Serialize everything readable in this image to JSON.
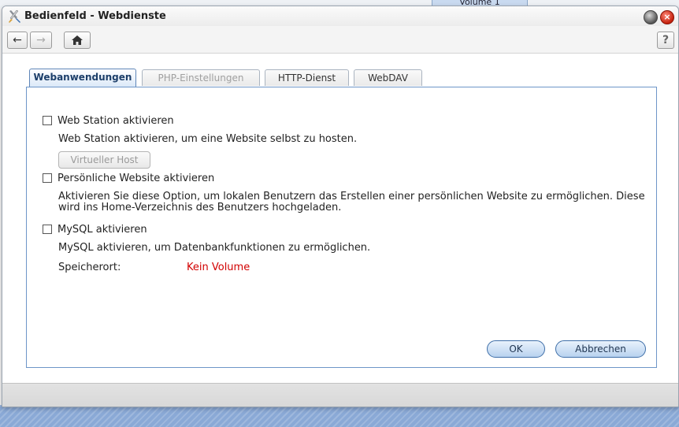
{
  "background": {
    "volume_label": "Volume 1"
  },
  "window": {
    "title": "Bedienfeld - Webdienste",
    "close_symbol": "×"
  },
  "toolbar": {
    "back_icon": "←",
    "forward_icon": "→",
    "home_icon": "⌂",
    "help_label": "?"
  },
  "tabs": [
    {
      "label": "Webanwendungen",
      "state": "active"
    },
    {
      "label": "PHP-Einstellungen",
      "state": "disabled"
    },
    {
      "label": "HTTP-Dienst",
      "state": "normal"
    },
    {
      "label": "WebDAV",
      "state": "normal"
    }
  ],
  "web_station": {
    "checkbox_label": "Web Station aktivieren",
    "checked": false,
    "description": "Web Station aktivieren, um eine Website selbst zu hosten.",
    "virtual_host_button": "Virtueller Host"
  },
  "personal_website": {
    "checkbox_label": "Persönliche Website aktivieren",
    "checked": false,
    "description_line1": "Aktivieren Sie diese Option, um lokalen Benutzern das Erstellen einer persönlichen Website zu ermöglichen. Diese",
    "description_line2": "wird ins Home-Verzeichnis des Benutzers hochgeladen."
  },
  "mysql": {
    "checkbox_label": "MySQL aktivieren",
    "checked": false,
    "description": "MySQL aktivieren, um Datenbankfunktionen zu ermöglichen.",
    "location_label": "Speicherort:",
    "location_value": "Kein Volume"
  },
  "buttons": {
    "ok": "OK",
    "cancel": "Abbrechen"
  },
  "colors": {
    "accent": "#6e96c8",
    "error": "#d20000"
  }
}
